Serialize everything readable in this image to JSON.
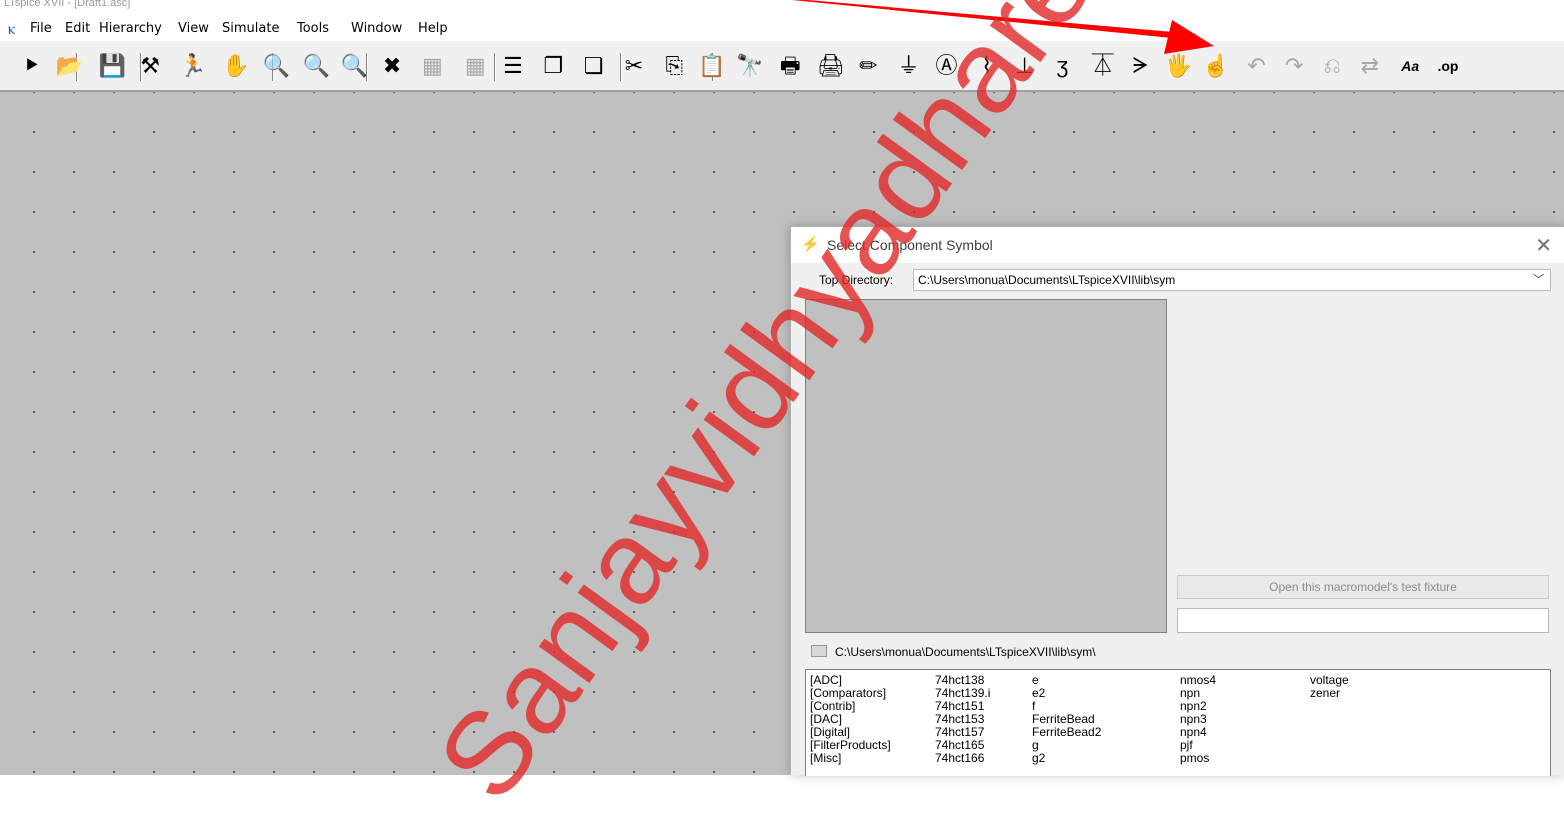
{
  "window": {
    "title": "LTspice XVII - [Draft1.asc]"
  },
  "menu": {
    "items": [
      {
        "label": "File"
      },
      {
        "label": "Edit"
      },
      {
        "label": "Hierarchy"
      },
      {
        "label": "View"
      },
      {
        "label": "Simulate"
      },
      {
        "label": "Tools"
      },
      {
        "label": "Window"
      },
      {
        "label": "Help"
      }
    ]
  },
  "toolbar": {
    "icons": [
      {
        "name": "run-icon",
        "glyph": "⯈"
      },
      {
        "name": "open-icon",
        "glyph": "📂"
      },
      {
        "name": "save-icon",
        "glyph": "💾"
      },
      {
        "name": "control-panel-icon",
        "glyph": "⚒"
      },
      {
        "name": "halt-icon",
        "glyph": "🏃"
      },
      {
        "name": "pan-icon",
        "glyph": "✋"
      },
      {
        "name": "zoom-in-icon",
        "glyph": "🔍"
      },
      {
        "name": "zoom-full-icon",
        "glyph": "🔍"
      },
      {
        "name": "zoom-out-icon",
        "glyph": "🔍"
      },
      {
        "name": "zoom-cancel-icon",
        "glyph": "✖"
      },
      {
        "name": "autorange-icon",
        "glyph": "▦"
      },
      {
        "name": "plot-settings-icon",
        "glyph": "▦"
      },
      {
        "name": "tile-horizontal-icon",
        "glyph": "☰"
      },
      {
        "name": "tile-vertical-icon",
        "glyph": "❐"
      },
      {
        "name": "cascade-icon",
        "glyph": "❏"
      },
      {
        "name": "cut-icon",
        "glyph": "✂"
      },
      {
        "name": "copy-icon",
        "glyph": "⎘"
      },
      {
        "name": "paste-icon",
        "glyph": "📋"
      },
      {
        "name": "find-icon",
        "glyph": "🔭"
      },
      {
        "name": "print-preview-icon",
        "glyph": "🖶"
      },
      {
        "name": "print-icon",
        "glyph": "🖨"
      },
      {
        "name": "draw-wire-icon",
        "glyph": "✏"
      },
      {
        "name": "ground-icon",
        "glyph": "⏚"
      },
      {
        "name": "label-net-icon",
        "glyph": "Ⓐ"
      },
      {
        "name": "resistor-icon",
        "glyph": "⌇"
      },
      {
        "name": "capacitor-icon",
        "glyph": "⊥"
      },
      {
        "name": "inductor-icon",
        "glyph": "ʒ"
      },
      {
        "name": "diode-icon",
        "glyph": "⏄"
      },
      {
        "name": "component-icon",
        "glyph": "ᗒ"
      },
      {
        "name": "move-icon",
        "glyph": "🖐"
      },
      {
        "name": "drag-icon",
        "glyph": "☝"
      },
      {
        "name": "undo-icon",
        "glyph": "↶"
      },
      {
        "name": "redo-icon",
        "glyph": "↷"
      },
      {
        "name": "rotate-icon",
        "glyph": "⎌"
      },
      {
        "name": "mirror-icon",
        "glyph": "⇄"
      },
      {
        "name": "text-icon",
        "glyph": "Aa"
      },
      {
        "name": "spice-directive-icon",
        "glyph": ".op"
      }
    ]
  },
  "watermark": {
    "text": "Sanjayvidhyadhare"
  },
  "dialog": {
    "title": "Select Component Symbol",
    "close_label": "✕",
    "top_directory_label": "Top Directory:",
    "top_directory_value": "C:\\Users\\monua\\Documents\\LTspiceXVII\\lib\\sym",
    "fixture_button_label": "Open this macromodel's test fixture",
    "current_path": "C:\\Users\\monua\\Documents\\LTspiceXVII\\lib\\sym\\",
    "columns": [
      [
        "[ADC]",
        "[Comparators]",
        "[Contrib]",
        "[DAC]",
        "[Digital]",
        "[FilterProducts]",
        "[Misc]"
      ],
      [
        "74hct138",
        "74hct139.i",
        "74hct151",
        "74hct153",
        "74hct157",
        "74hct165",
        "74hct166"
      ],
      [
        "e",
        "e2",
        "f",
        "FerriteBead",
        "FerriteBead2",
        "g",
        "g2"
      ],
      [
        "nmos4",
        "npn",
        "npn2",
        "npn3",
        "npn4",
        "pjf",
        "pmos"
      ],
      [
        "voltage",
        "zener"
      ]
    ]
  },
  "colors": {
    "canvas": "#c0c0c0",
    "watermark": "#e02828",
    "arrow": "#ff0000"
  }
}
